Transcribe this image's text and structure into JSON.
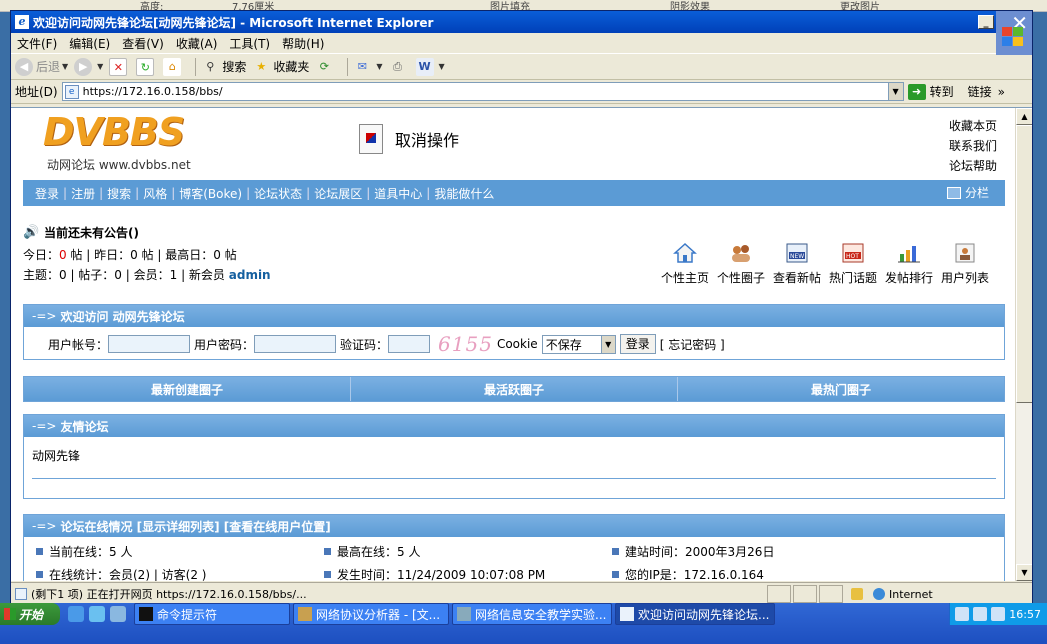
{
  "bg_strip": [
    "高度:",
    "7.76厘米",
    "图片填充",
    "阴影效果",
    "更改图片"
  ],
  "window": {
    "title": "欢迎访问动网先锋论坛[动网先锋论坛] - Microsoft Internet Explorer",
    "menu": [
      "文件(F)",
      "编辑(E)",
      "查看(V)",
      "收藏(A)",
      "工具(T)",
      "帮助(H)"
    ],
    "toolbar": {
      "back": "后退",
      "search": "搜索",
      "favorites": "收藏夹"
    },
    "address": {
      "label": "地址(D)",
      "url": "https://172.16.0.158/bbs/",
      "go": "转到",
      "links": "链接"
    }
  },
  "page": {
    "logo_text": "DVBBS",
    "logo_sub": "动网论坛 www.dvbbs.net",
    "cancel_text": "取消操作",
    "top_links": [
      "收藏本页",
      "联系我们",
      "论坛帮助"
    ],
    "nav": [
      "登录",
      "注册",
      "搜索",
      "风格",
      "博客(Boke)",
      "论坛状态",
      "论坛展区",
      "道具中心",
      "我能做什么"
    ],
    "split_label": "分栏",
    "notice": "当前还未有公告()",
    "stats": {
      "today_label": "今日：",
      "today_value": "0",
      "today_unit": "帖 | 昨日：0 帖 | 最高日：0 帖",
      "line2": "主题：0 | 帖子：0 | 会员：1 | 新会员",
      "new_member": "admin"
    },
    "icon_links": [
      "个性主页",
      "个性圈子",
      "查看新帖",
      "热门话题",
      "发帖排行",
      "用户列表"
    ],
    "login_panel": {
      "title": "欢迎访问 动网先锋论坛",
      "arrow": "-=>",
      "user_label": "用户帐号：",
      "pass_label": "用户密码：",
      "code_label": "验证码：",
      "captcha": "6155",
      "cookie_label": "Cookie",
      "cookie_value": "不保存",
      "login_button": "登录",
      "forgot": "[ 忘记密码 ]"
    },
    "circles": [
      "最新创建圈子",
      "最活跃圈子",
      "最热门圈子"
    ],
    "friend_panel": {
      "arrow": "-=>",
      "title": "友情论坛",
      "item": "动网先锋"
    },
    "online_panel": {
      "arrow": "-=>",
      "title": "论坛在线情况 [显示详细列表] [查看在线用户位置]",
      "items": [
        "当前在线：5 人",
        "最高在线：5 人",
        "建站时间：2000年3月26日",
        "在线统计：会员(2) | 访客(2 )",
        "发生时间：11/24/2009 10:07:08 PM",
        "您的IP是：172.16.0.164"
      ]
    }
  },
  "statusbar": {
    "text": "(剩下1 项) 正在打开网页 https://172.16.0.158/bbs/...",
    "zone": "Internet"
  },
  "taskbar": {
    "start": "开始",
    "tasks": [
      "命令提示符",
      "网络协议分析器 - [文...",
      "网络信息安全教学实验...",
      "欢迎访问动网先锋论坛..."
    ],
    "time": "16:57"
  },
  "colors": {
    "title_blue": "#0a5ed8",
    "nav_blue": "#5b9bd5",
    "taskbar_blue": "#3168d5"
  }
}
